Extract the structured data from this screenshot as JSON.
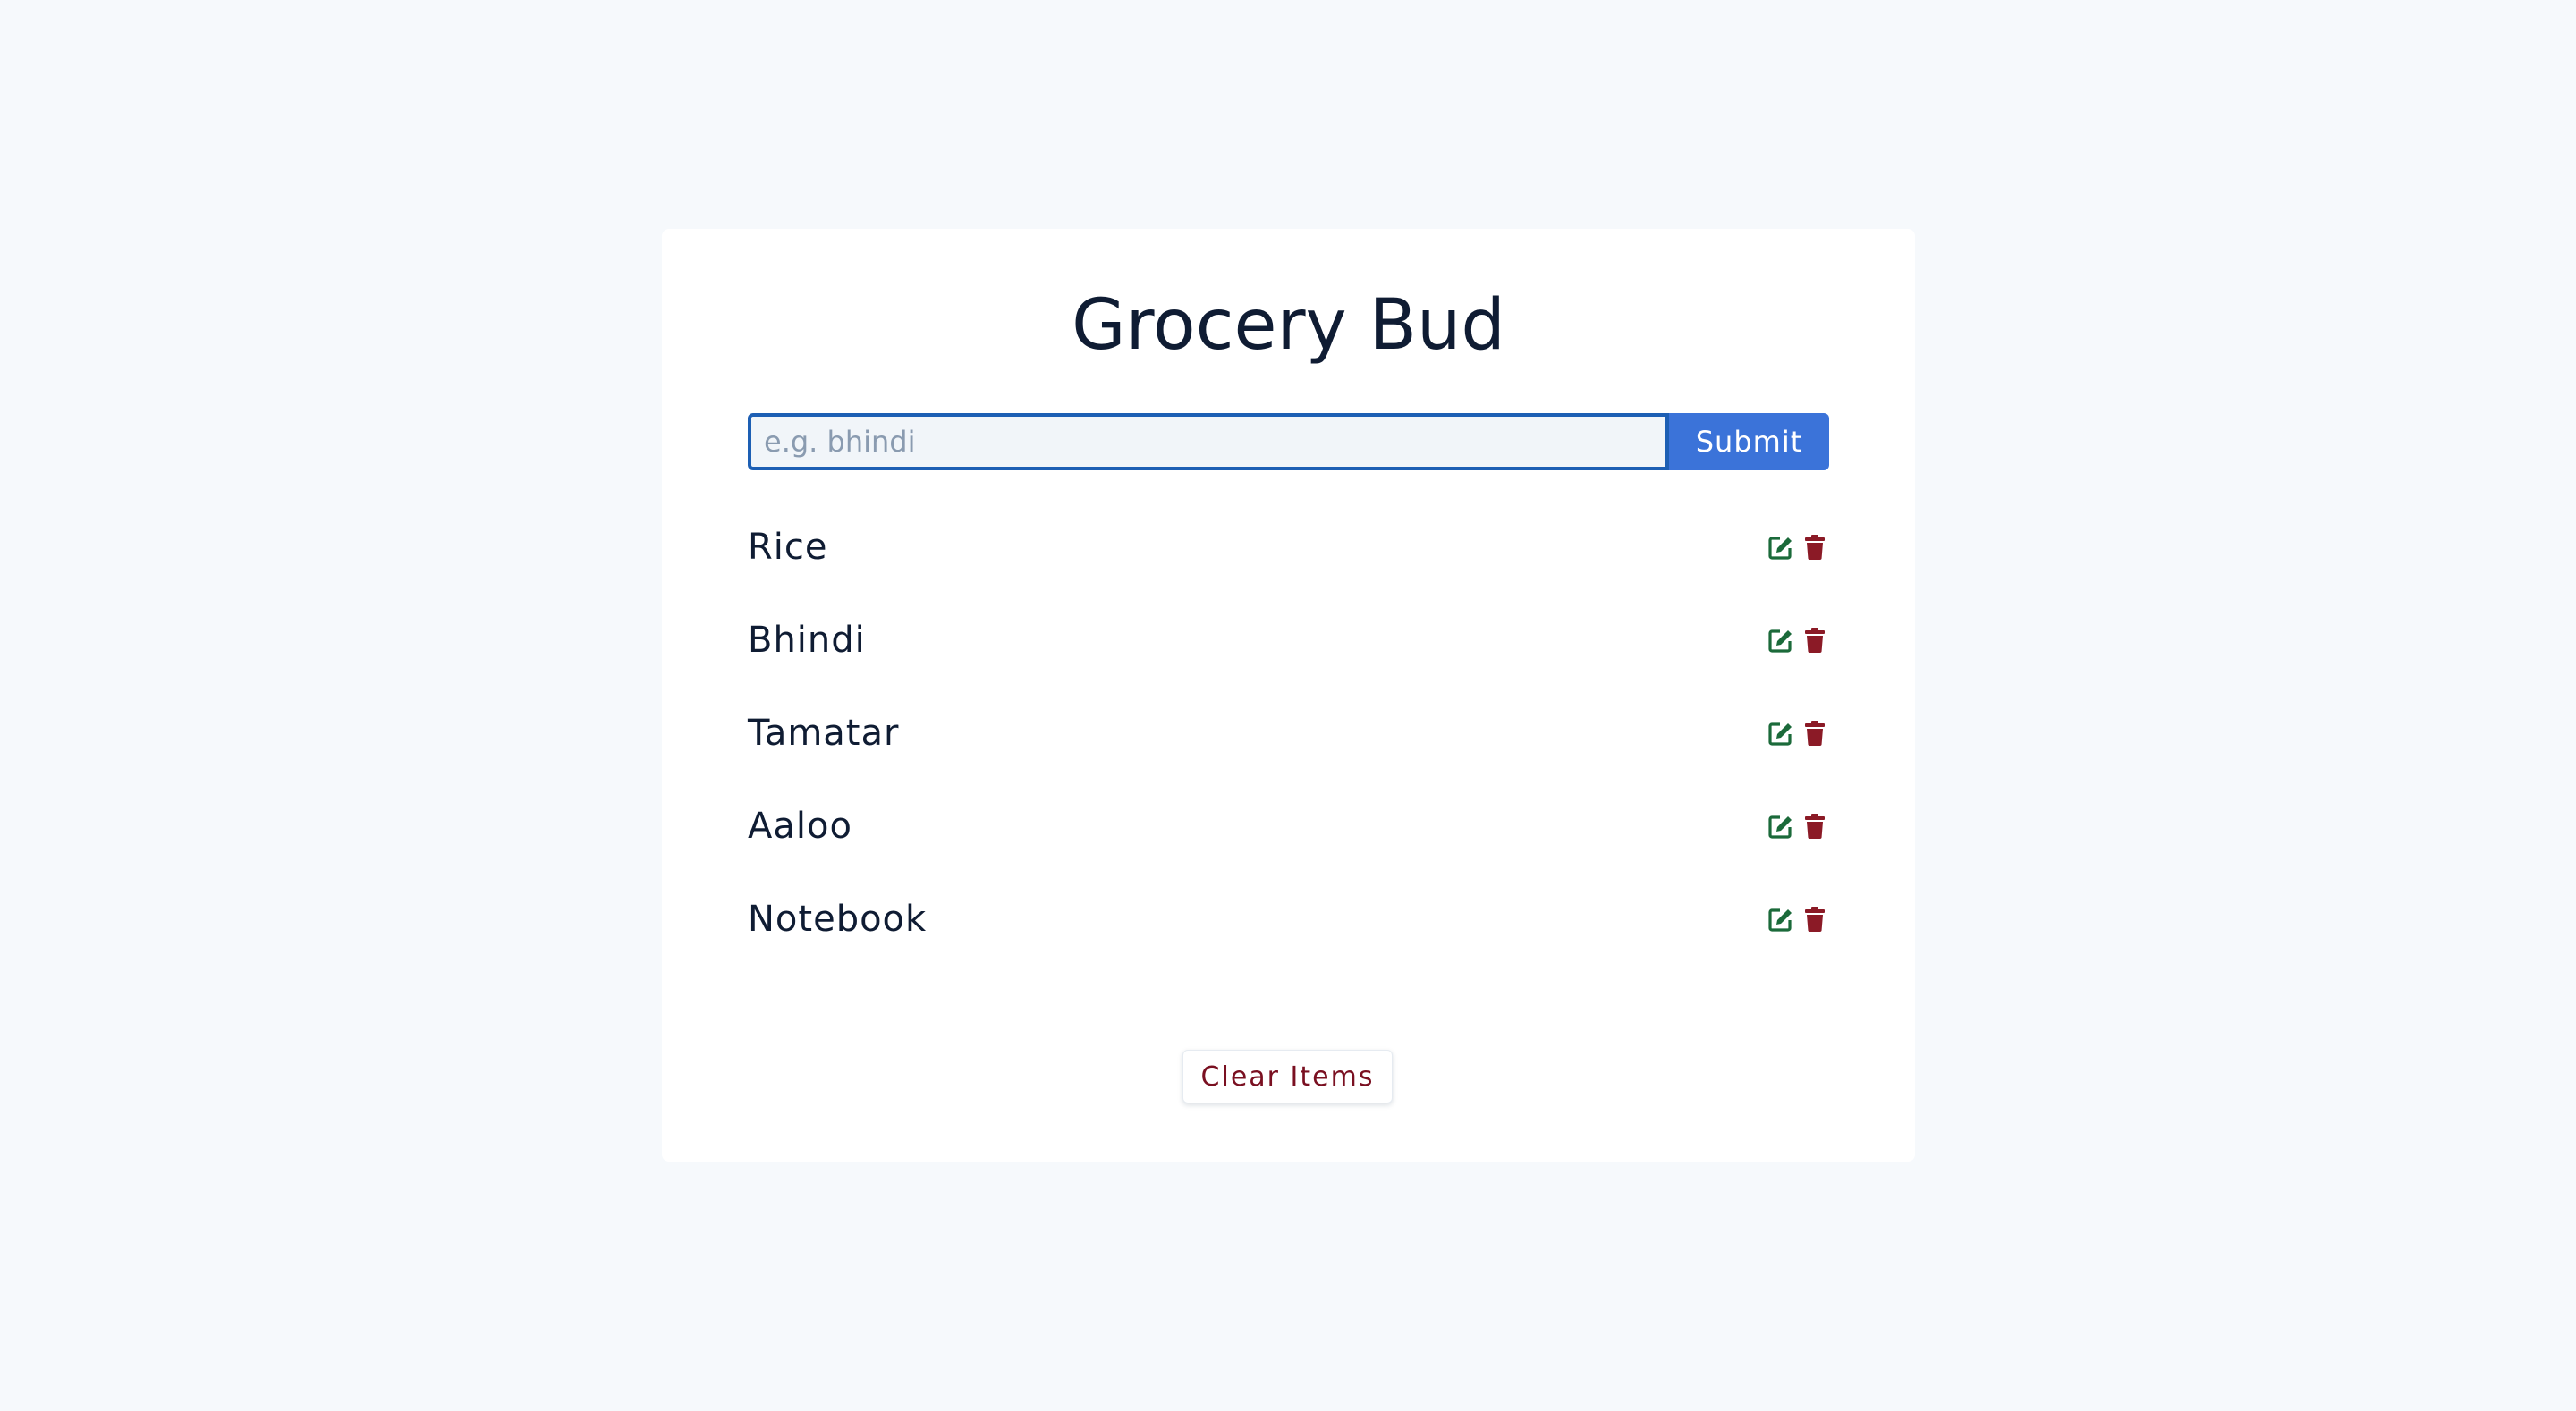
{
  "app": {
    "title": "Grocery Bud"
  },
  "form": {
    "input_value": "",
    "input_placeholder": "e.g. bhindi",
    "submit_label": "Submit"
  },
  "items": [
    {
      "name": "Rice"
    },
    {
      "name": "Bhindi"
    },
    {
      "name": "Tamatar"
    },
    {
      "name": "Aaloo"
    },
    {
      "name": "Notebook"
    }
  ],
  "item_actions": {
    "edit_icon": "edit-icon",
    "delete_icon": "trash-icon"
  },
  "clear_label": "Clear Items",
  "colors": {
    "background": "#f6f9fc",
    "card": "#ffffff",
    "primary": "#3b73d9",
    "input_border": "#1d5fb4",
    "edit_icon": "#1b6a3a",
    "delete_icon": "#8b1a26",
    "clear_text": "#7a1021"
  }
}
